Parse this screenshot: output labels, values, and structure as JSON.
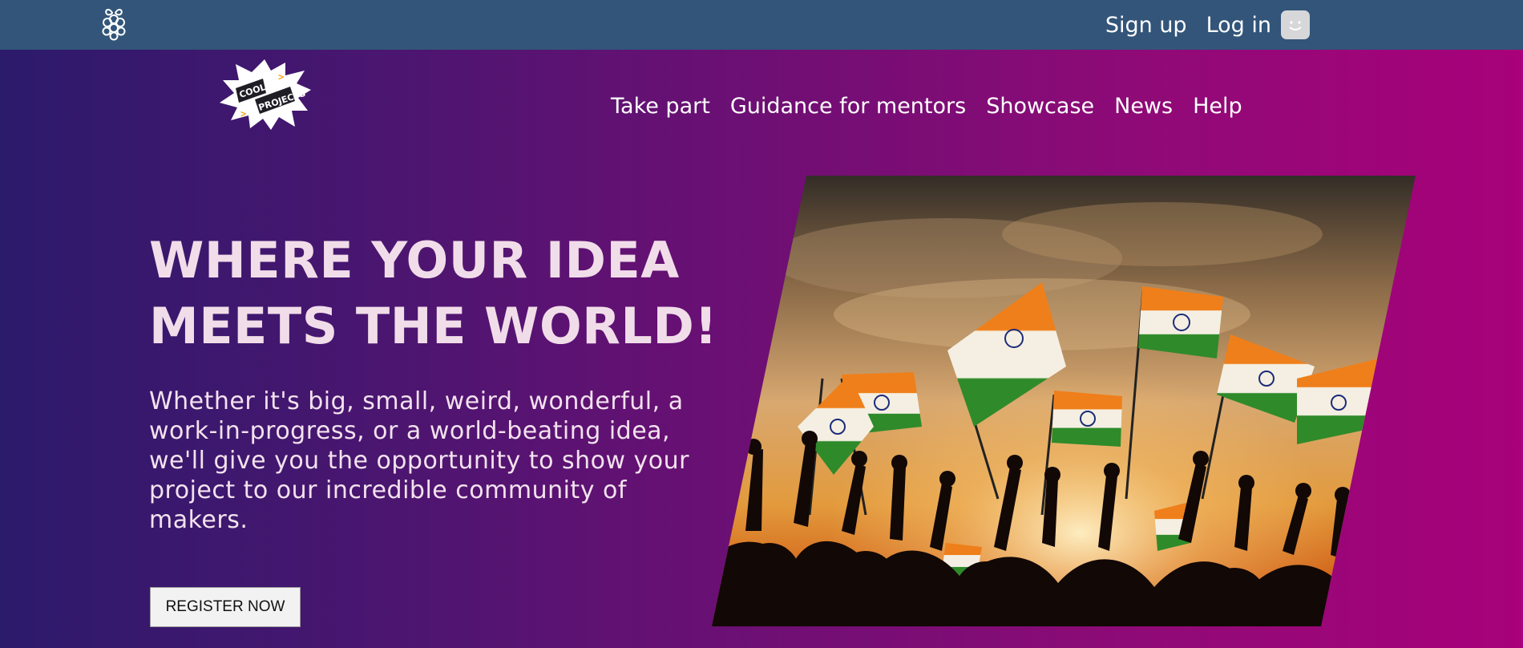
{
  "topbar": {
    "signup_label": "Sign up",
    "login_label": "Log in",
    "logo_icon": "raspberry-pi-icon",
    "avatar_icon": "smiley-avatar-icon"
  },
  "header": {
    "logo_text_line1": "COOLEST",
    "logo_text_line2": "PROJECTS",
    "nav": [
      {
        "label": "Take part"
      },
      {
        "label": "Guidance for mentors"
      },
      {
        "label": "Showcase"
      },
      {
        "label": "News"
      },
      {
        "label": "Help"
      }
    ]
  },
  "hero": {
    "headline_line1": "WHERE YOUR IDEA",
    "headline_line2": "MEETS THE WORLD!",
    "subtext": "Whether it's big, small, weird, wonderful, a work-in-progress, or a world-beating idea, we'll give you the opportunity to show your project to our incredible community of makers.",
    "cta_label": "REGISTER NOW",
    "image_subject": "crowd-waving-indian-flags-at-sunset"
  },
  "colors": {
    "topbar": "#325579",
    "gradient_start": "#2c1a6b",
    "gradient_end": "#a8017a",
    "headline": "#f1dde9"
  }
}
